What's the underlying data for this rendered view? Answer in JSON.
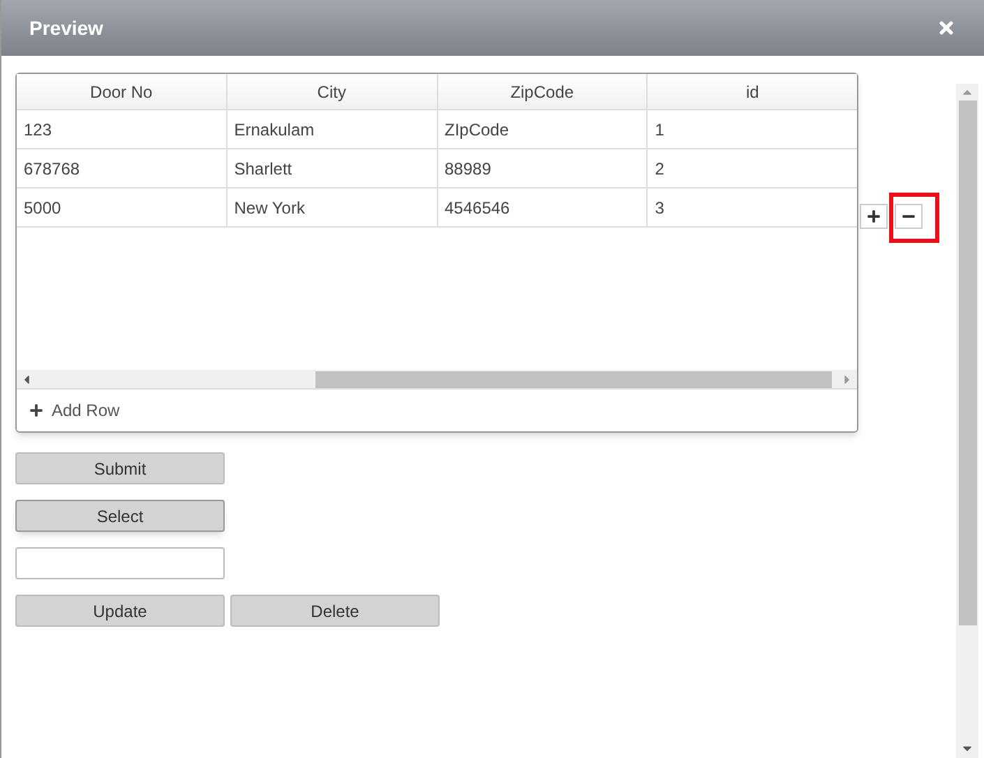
{
  "window": {
    "title": "Preview"
  },
  "table": {
    "columns": [
      "Door No",
      "City",
      "ZipCode",
      "id"
    ],
    "rows": [
      [
        "123",
        "Ernakulam",
        "ZIpCode",
        "1"
      ],
      [
        "678768",
        "Sharlett",
        "88989",
        "2"
      ],
      [
        "5000",
        "New York",
        "4546546",
        "3"
      ]
    ],
    "add_row": "Add Row"
  },
  "buttons": [
    {
      "label": "Submit",
      "focused": false
    },
    {
      "label": "Select",
      "focused": true
    }
  ],
  "actions": [
    "Update",
    "Delete"
  ]
}
